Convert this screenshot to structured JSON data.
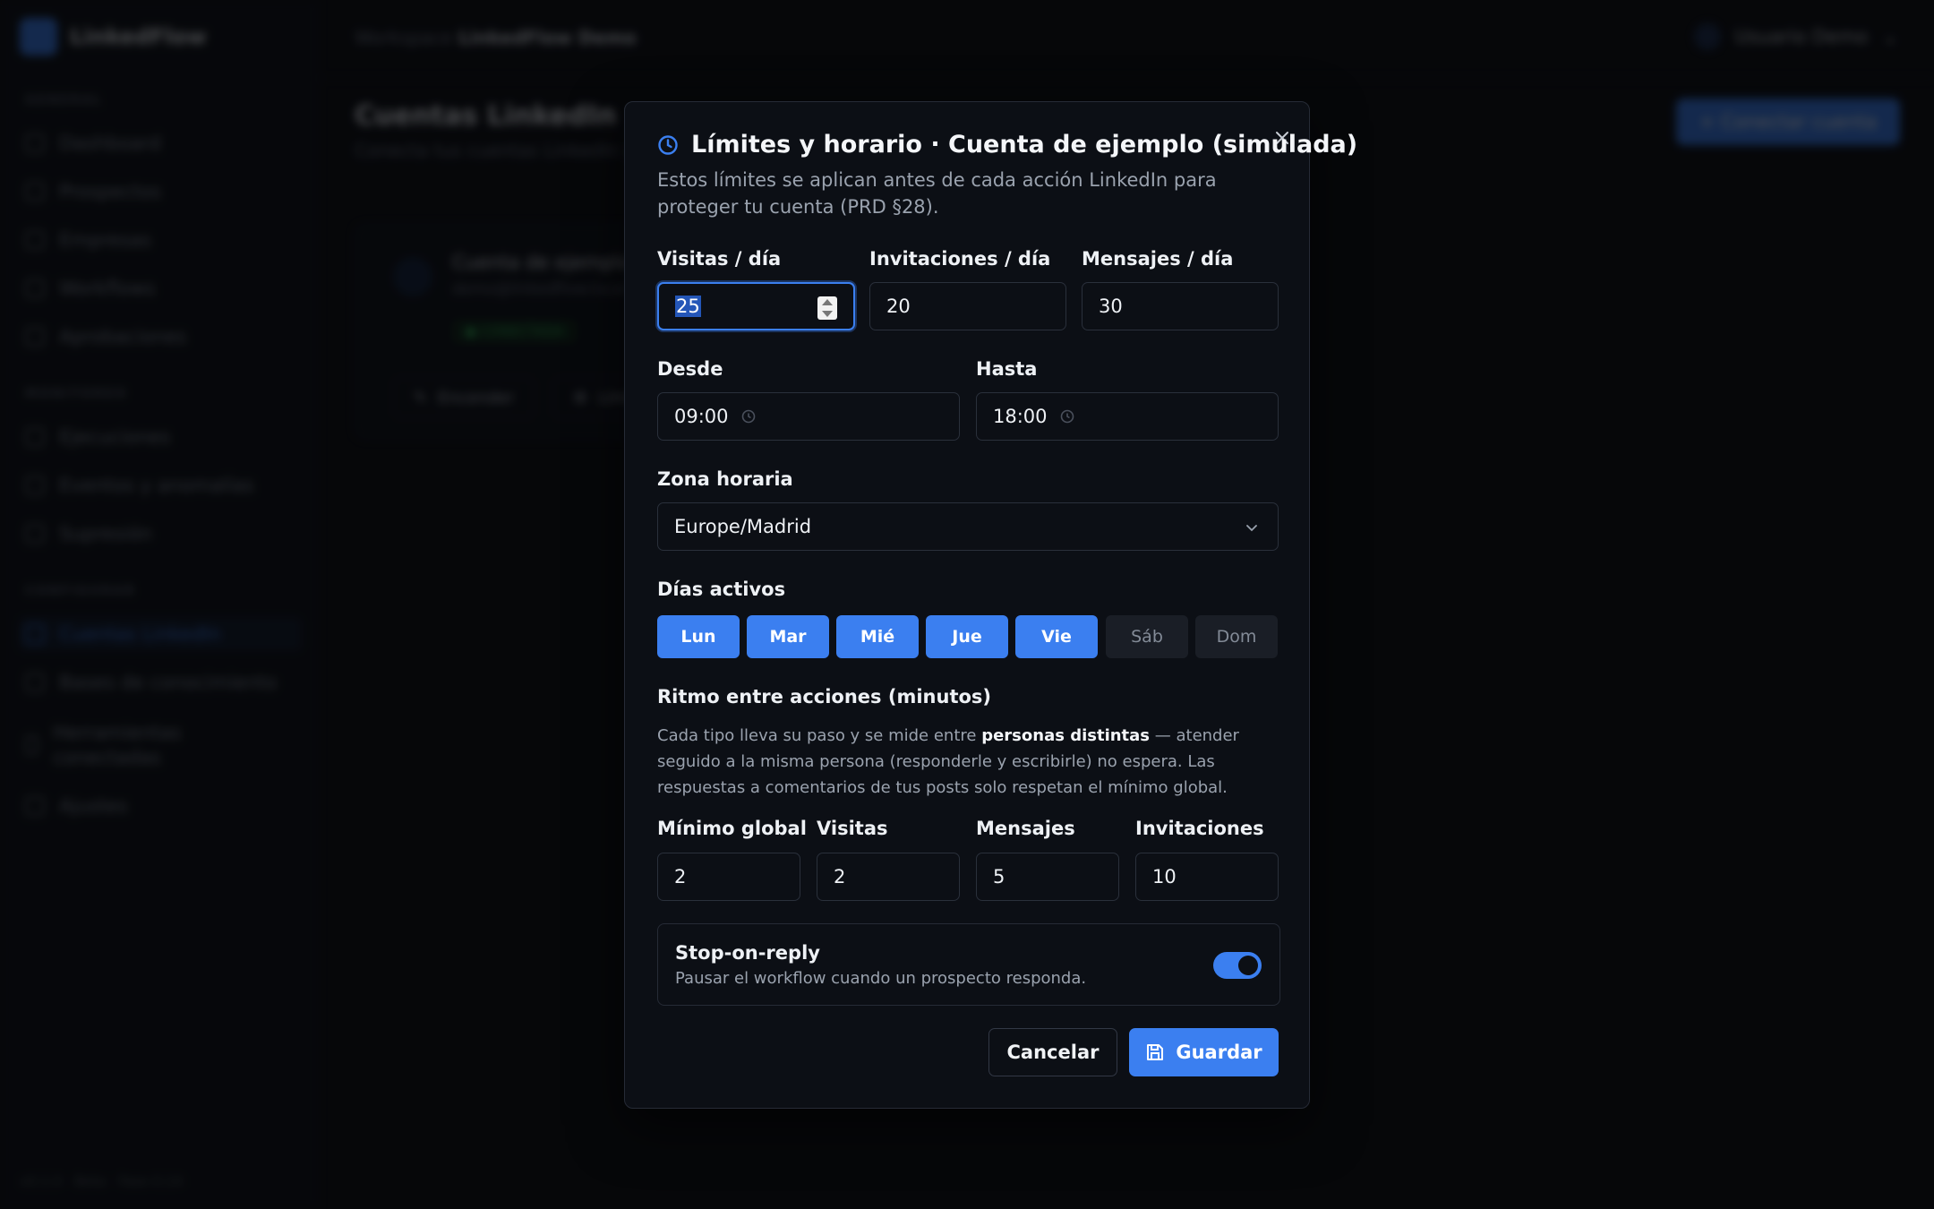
{
  "app": {
    "name": "LinkedFlow",
    "version_footer": "v0.1.0 · Beta · Fase 0.14"
  },
  "nav": {
    "section_general": "GENERAL",
    "section_monitoring": "MONITOREO",
    "section_config": "CONFIGURAR",
    "items": [
      {
        "label": "Dashboard",
        "icon": "grid-icon"
      },
      {
        "label": "Prospectos",
        "icon": "user-icon"
      },
      {
        "label": "Empresas",
        "icon": "building-icon"
      },
      {
        "label": "Workflows",
        "icon": "workflow-icon"
      },
      {
        "label": "Aprobaciones",
        "icon": "check-icon"
      },
      {
        "label": "Ejecuciones",
        "icon": "activity-icon"
      },
      {
        "label": "Eventos y anomalías",
        "icon": "alert-icon"
      },
      {
        "label": "Supresión",
        "icon": "block-icon"
      },
      {
        "label": "Cuentas LinkedIn",
        "icon": "linkedin-icon"
      },
      {
        "label": "Bases de conocimiento",
        "icon": "book-icon"
      },
      {
        "label": "Herramientas conectadas",
        "icon": "tool-icon"
      },
      {
        "label": "Ajustes",
        "icon": "gear-icon"
      }
    ]
  },
  "topbar": {
    "breadcrumb_prefix": "Workspace",
    "breadcrumb_current": "LinkedFlow Demo",
    "user_name": "Usuario Demo"
  },
  "page": {
    "title": "Cuentas LinkedIn",
    "subtitle": "Conecta tus cuentas LinkedIn y ajusta sus límites",
    "connect_button": "+ Conectar cuenta",
    "account": {
      "name": "Cuenta de ejemplo (simulada)",
      "email": "demo@linkedflow.local",
      "status": "● CONECTADA",
      "action_edit": "Encender",
      "action_limits": "Límites"
    }
  },
  "modal": {
    "title": "Límites y horario · Cuenta de ejemplo (simulada)",
    "description": "Estos límites se aplican antes de cada acción LinkedIn para proteger tu cuenta (PRD §28).",
    "visits_label": "Visitas / día",
    "visits_value": "25",
    "invites_label": "Invitaciones / día",
    "invites_value": "20",
    "messages_label": "Mensajes / día",
    "messages_value": "30",
    "from_label": "Desde",
    "from_value": "09:00",
    "to_label": "Hasta",
    "to_value": "18:00",
    "timezone_label": "Zona horaria",
    "timezone_value": "Europe/Madrid",
    "days_label": "Días activos",
    "days": [
      {
        "label": "Lun",
        "active": true
      },
      {
        "label": "Mar",
        "active": true
      },
      {
        "label": "Mié",
        "active": true
      },
      {
        "label": "Jue",
        "active": true
      },
      {
        "label": "Vie",
        "active": true
      },
      {
        "label": "Sáb",
        "active": false
      },
      {
        "label": "Dom",
        "active": false
      }
    ],
    "pace_label": "Ritmo entre acciones (minutos)",
    "pace_desc_1": "Cada tipo lleva su paso y se mide entre ",
    "pace_desc_bold": "personas distintas",
    "pace_desc_2": " — atender seguido a la misma persona (responderle y escribirle) no espera. Las respuestas a comentarios de tus posts solo respetan el mínimo global.",
    "min_global_label": "Mínimo global",
    "min_global_value": "2",
    "pace_visits_label": "Visitas",
    "pace_visits_value": "2",
    "pace_messages_label": "Mensajes",
    "pace_messages_value": "5",
    "pace_invites_label": "Invitaciones",
    "pace_invites_value": "10",
    "stop_title": "Stop-on-reply",
    "stop_desc": "Pausar el workflow cuando un prospecto responda.",
    "stop_enabled": true,
    "cancel_label": "Cancelar",
    "save_label": "Guardar"
  },
  "colors": {
    "accent": "#3b7ff0",
    "background": "#0b0d12",
    "modal_bg": "#0c0f15",
    "success": "#31b057"
  }
}
